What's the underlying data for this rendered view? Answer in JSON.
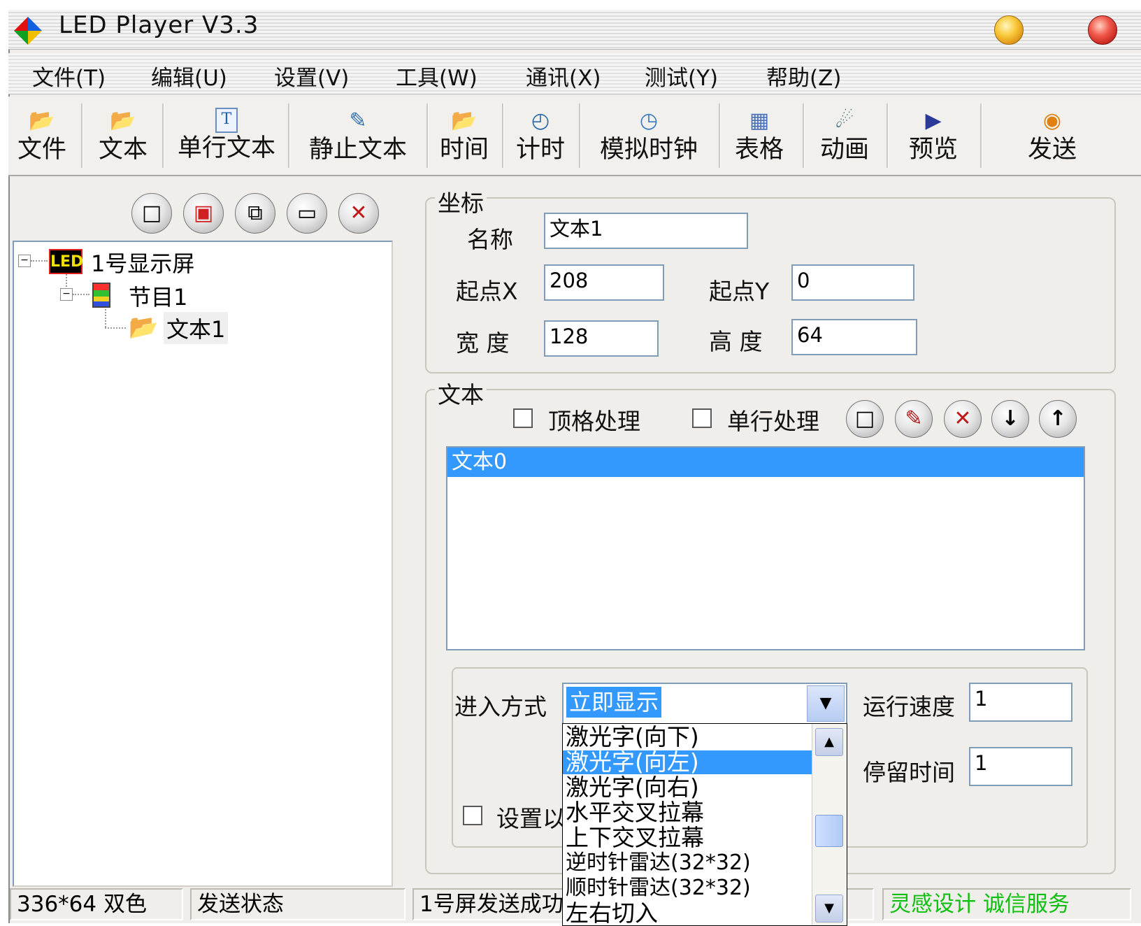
{
  "app": {
    "title": "LED Player V3.3"
  },
  "menu": [
    "文件(T)",
    "编辑(U)",
    "设置(V)",
    "工具(W)",
    "通讯(X)",
    "测试(Y)",
    "帮助(Z)"
  ],
  "toolbar": [
    "文件",
    "文本",
    "单行文本",
    "静止文本",
    "时间",
    "计时",
    "模拟时钟",
    "表格",
    "动画",
    "预览",
    "发送"
  ],
  "tree": {
    "screen": {
      "badge": "LED",
      "label": "1号显示屏"
    },
    "program": {
      "label": "节目1"
    },
    "text": {
      "label": "文本1"
    }
  },
  "coords": {
    "legend": "坐标",
    "name_label": "名称",
    "name_value": "文本1",
    "x_label": "起点X",
    "x_value": "208",
    "y_label": "起点Y",
    "y_value": "0",
    "width_label": "宽 度",
    "width_value": "128",
    "height_label": "高 度",
    "height_value": "64"
  },
  "text_group": {
    "legend": "文本",
    "top_align_label": "顶格处理",
    "single_line_label": "单行处理",
    "items": [
      "文本0"
    ]
  },
  "effects": {
    "entry_label": "进入方式",
    "entry_value": "立即显示",
    "speed_label": "运行速度",
    "speed_value": "1",
    "stay_label": "停留时间",
    "stay_value": "1",
    "set_checkbox_label": "设置以",
    "options": [
      "激光字(向下)",
      "激光字(向左)",
      "激光字(向右)",
      "水平交叉拉幕",
      "上下交叉拉幕",
      "逆时针雷达(32*32)",
      "顺时针雷达(32*32)",
      "左右切入"
    ],
    "selected_option": "激光字(向左)"
  },
  "status": {
    "resolution": "336*64 双色",
    "send_state": "发送状态",
    "message": "1号屏发送成功",
    "slogan": "灵感设计 诚信服务",
    "slogan_color": "#10c010"
  }
}
